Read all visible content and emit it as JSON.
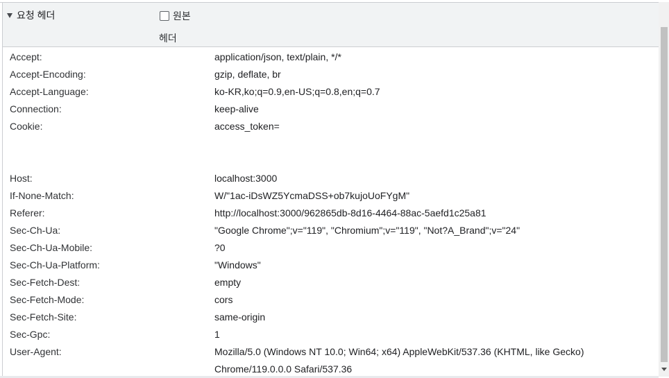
{
  "section": {
    "title": "요청 헤더",
    "raw_label_line1": "원본",
    "raw_label_line2": "헤더"
  },
  "headers": [
    {
      "key": "Accept:",
      "value": "application/json, text/plain, */*"
    },
    {
      "key": "Accept-Encoding:",
      "value": "gzip, deflate, br"
    },
    {
      "key": "Accept-Language:",
      "value": "ko-KR,ko;q=0.9,en-US;q=0.8,en;q=0.7"
    },
    {
      "key": "Connection:",
      "value": "keep-alive"
    },
    {
      "key": "Cookie:",
      "value": "access_token="
    },
    {
      "key": "Host:",
      "value": "localhost:3000"
    },
    {
      "key": "If-None-Match:",
      "value": "W/\"1ac-iDsWZ5YcmaDSS+ob7kujoUoFYgM\""
    },
    {
      "key": "Referer:",
      "value": "http://localhost:3000/962865db-8d16-4464-88ac-5aefd1c25a81"
    },
    {
      "key": "Sec-Ch-Ua:",
      "value": "\"Google Chrome\";v=\"119\", \"Chromium\";v=\"119\", \"Not?A_Brand\";v=\"24\""
    },
    {
      "key": "Sec-Ch-Ua-Mobile:",
      "value": "?0"
    },
    {
      "key": "Sec-Ch-Ua-Platform:",
      "value": "\"Windows\""
    },
    {
      "key": "Sec-Fetch-Dest:",
      "value": "empty"
    },
    {
      "key": "Sec-Fetch-Mode:",
      "value": "cors"
    },
    {
      "key": "Sec-Fetch-Site:",
      "value": "same-origin"
    },
    {
      "key": "Sec-Gpc:",
      "value": "1"
    },
    {
      "key": "User-Agent:",
      "value": "Mozilla/5.0 (Windows NT 10.0; Win64; x64) AppleWebKit/537.36 (KHTML, like Gecko) Chrome/119.0.0.0 Safari/537.36"
    }
  ],
  "icons": {
    "expand": "triangle-down-icon",
    "checkbox": "checkbox-unchecked-icon",
    "scroll_down": "scroll-down-arrow-icon"
  }
}
